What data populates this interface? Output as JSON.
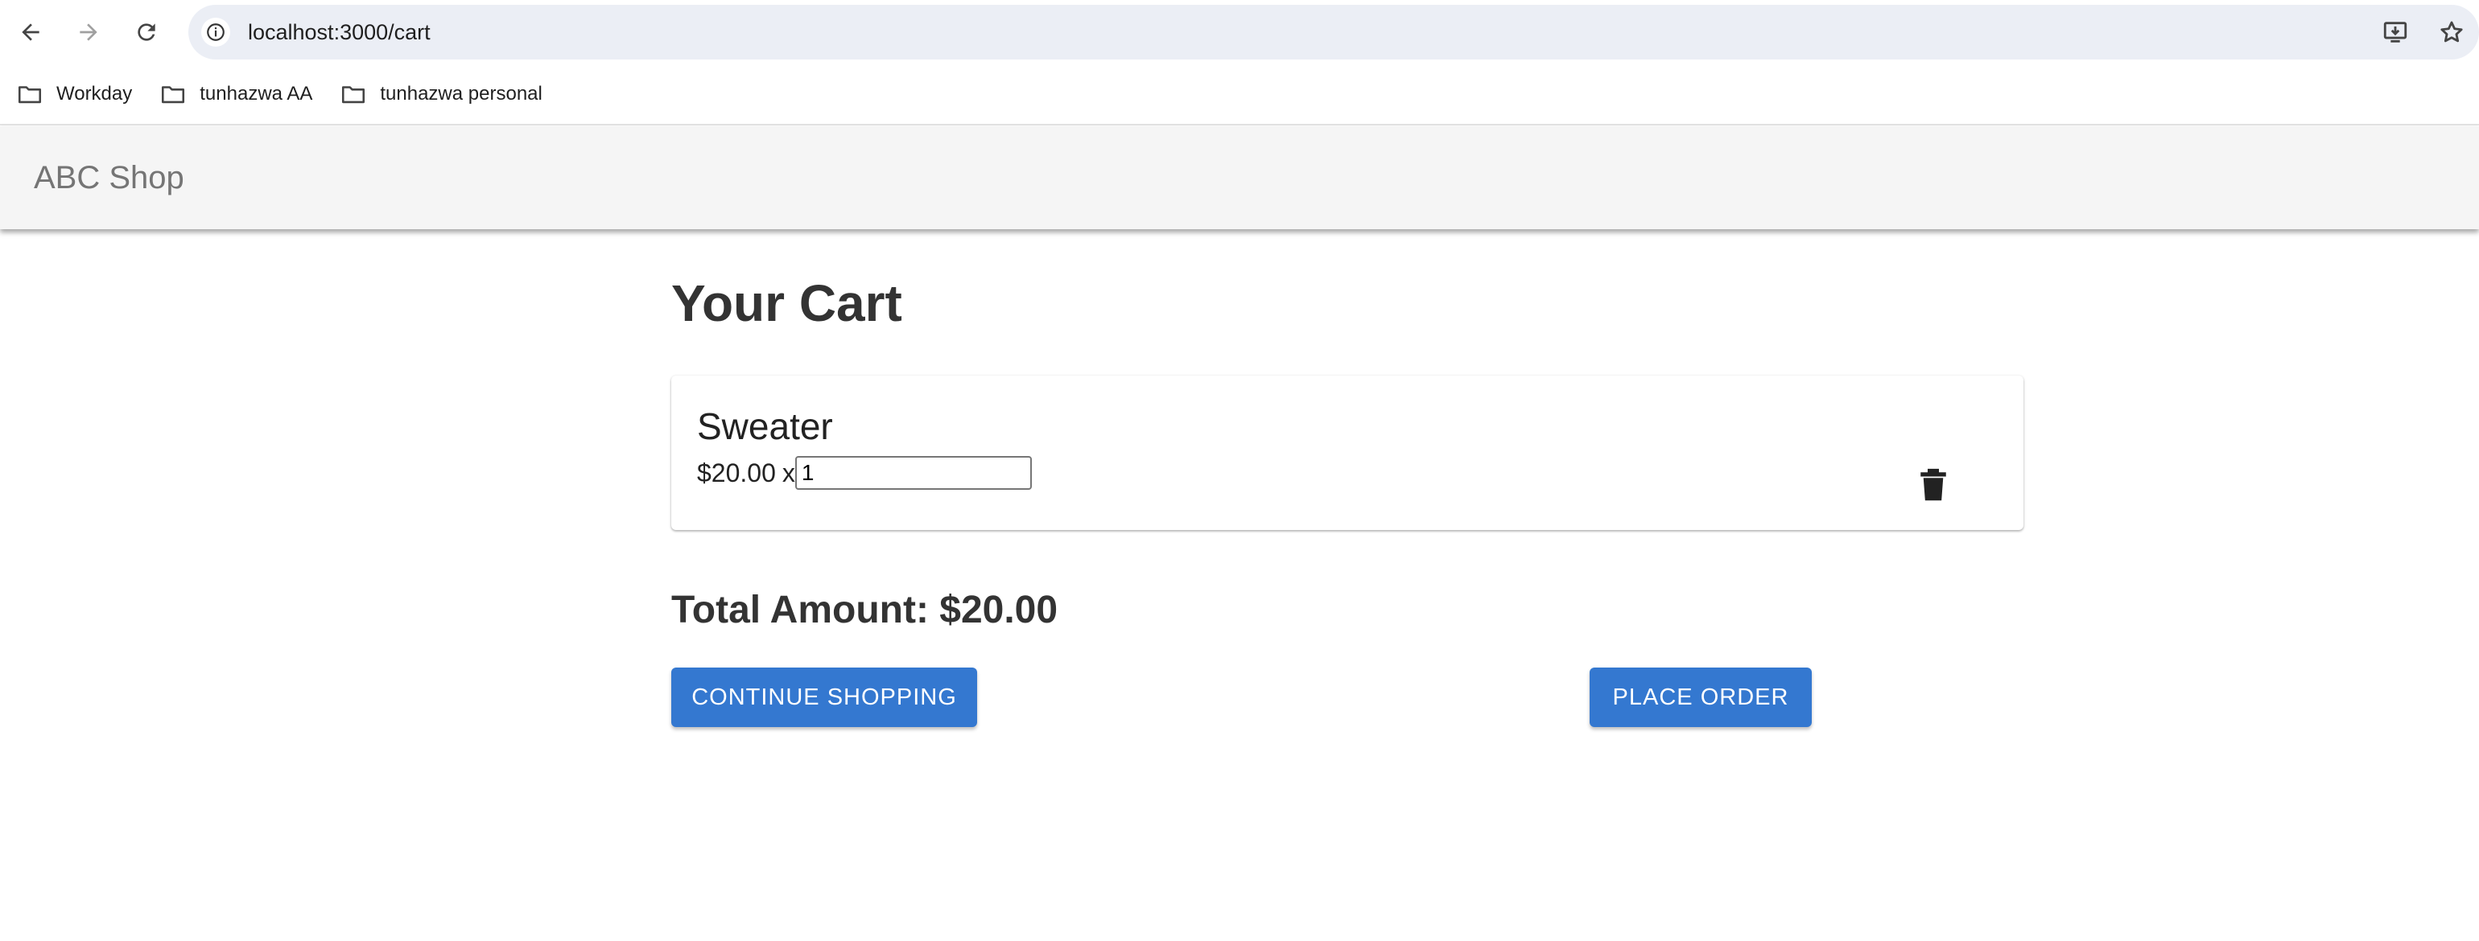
{
  "browser": {
    "url": "localhost:3000/cart",
    "bookmarks": [
      {
        "label": "Workday",
        "icon": "folder-icon"
      },
      {
        "label": "tunhazwa AA",
        "icon": "folder-icon"
      },
      {
        "label": "tunhazwa personal",
        "icon": "folder-icon"
      }
    ]
  },
  "app": {
    "brand": "ABC Shop"
  },
  "cart": {
    "title": "Your Cart",
    "items": [
      {
        "name": "Sweater",
        "price": "$20.00",
        "times": "x",
        "quantity": "1"
      }
    ],
    "total_label": "Total Amount: $20.00",
    "continue_label": "CONTINUE SHOPPING",
    "place_order_label": "PLACE ORDER"
  },
  "colors": {
    "primary": "#3478d0",
    "header_bg": "#f5f5f5",
    "omnibox_bg": "#ebeef5"
  }
}
